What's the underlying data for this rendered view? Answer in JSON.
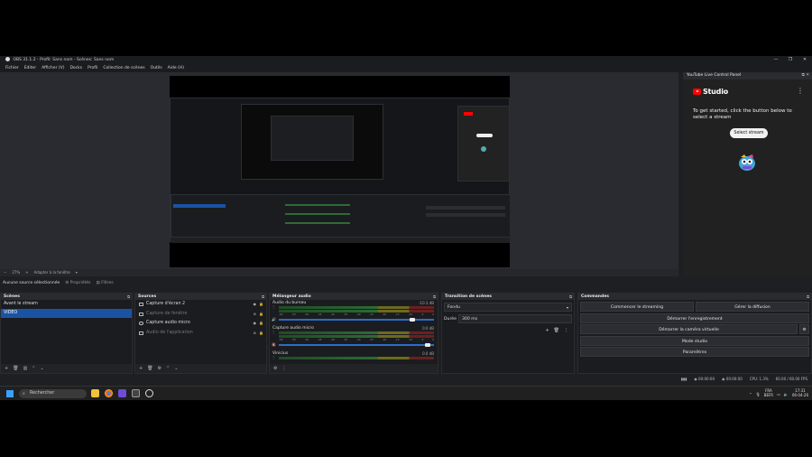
{
  "window": {
    "title": "OBS 31.1.2 - Profil: Sans nom - Scènes: Sans nom",
    "controls": [
      "—",
      "❐",
      "✕"
    ]
  },
  "menu": [
    "Fichier",
    "Editer",
    "Afficher (V)",
    "Docks",
    "Profil",
    "Collection de scènes",
    "Outils",
    "Aide (H)"
  ],
  "zoom": {
    "value": "27%",
    "mode": "Adapter à la fenêtre"
  },
  "youtube_panel": {
    "title": "YouTube Live Control Panel",
    "logo_text": "Studio",
    "description": "To get started, click the button below to select a stream",
    "button": "Select stream"
  },
  "source_status": {
    "text": "Aucune source sélectionnée",
    "properties": "Propriétés",
    "filters": "Filtres"
  },
  "scenes": {
    "title": "Scènes",
    "items": [
      {
        "label": "Avant le stream",
        "selected": false
      },
      {
        "label": "VIDEO",
        "selected": true
      }
    ]
  },
  "sources": {
    "title": "Sources",
    "items": [
      {
        "label": "Capture d'écran 2",
        "dim": false
      },
      {
        "label": "Capture de fenêtre",
        "dim": true
      },
      {
        "label": "Capture audio micro",
        "dim": false
      },
      {
        "label": "Audio de l'application",
        "dim": true
      }
    ]
  },
  "mixer": {
    "title": "Mélangeur audio",
    "ticks": [
      "-60",
      "-55",
      "-50",
      "-45",
      "-40",
      "-35",
      "-30",
      "-25",
      "-20",
      "-15",
      "-10",
      "-5",
      "0"
    ],
    "channels": [
      {
        "name": "Audio du bureau",
        "db": "-10.3 dB",
        "volume": 0.9
      },
      {
        "name": "Capture audio micro",
        "db": "0.0 dB",
        "volume": 1.0
      },
      {
        "name": "Vinicius",
        "db": "0.0 dB",
        "volume": 1.0
      }
    ]
  },
  "transitions": {
    "title": "Transition de scènes",
    "type": "Fondu",
    "duration_label": "Durée",
    "duration_value": "300 ms"
  },
  "controls": {
    "title": "Commandes",
    "start_streaming": "Commencer le streaming",
    "manage_broadcast": "Gérer la diffusion",
    "start_recording": "Démarrer l'enregistrement",
    "start_virtual_cam": "Démarrer la caméra virtuelle",
    "studio_mode": "Mode studio",
    "settings": "Paramètres"
  },
  "statusbar": {
    "rec": "00:00:00",
    "stream": "00:00:00",
    "cpu": "CPU: 1.3%",
    "fps": "60.00 / 60.00 FPS"
  },
  "taskbar": {
    "search": "Rechercher",
    "lang_top": "FRA",
    "lang_bottom": "BEFR",
    "time": "17:31",
    "date": "06-04-26"
  },
  "colors": {
    "accent": "#1b53a4",
    "bg": "#1e1f22",
    "yt_red": "#ff0000"
  }
}
